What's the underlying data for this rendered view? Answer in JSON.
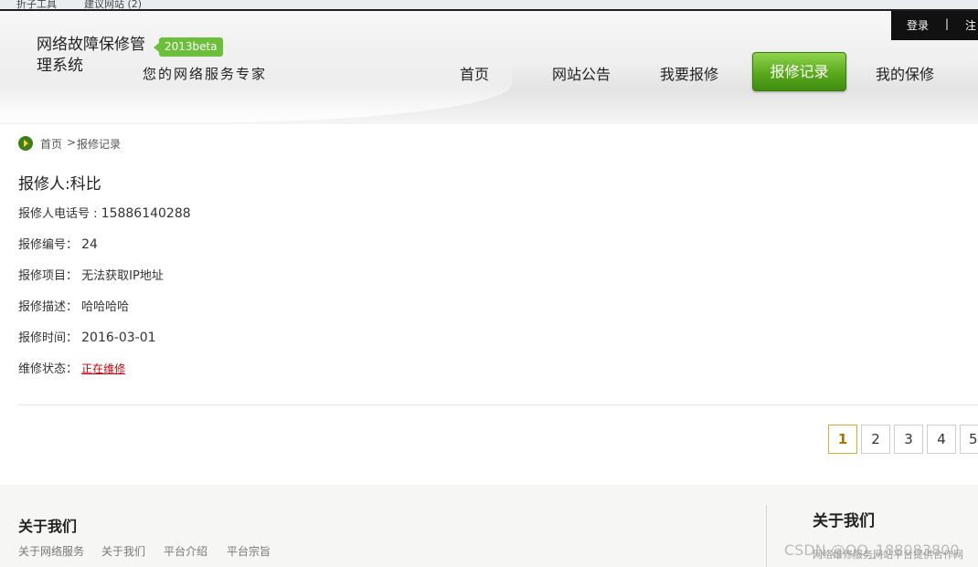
{
  "browser": {
    "tab1": "折子工具",
    "tab2": "建议网站 (2)"
  },
  "header": {
    "logo_text": "网络故障保修管理系统",
    "beta": "2013beta",
    "slogan": "您的网络服务专家",
    "login": "登录",
    "separator": "|",
    "register": "注"
  },
  "nav": {
    "items": [
      "首页",
      "网站公告",
      "我要报修",
      "报修记录",
      "我的保修"
    ],
    "active_index": 3
  },
  "breadcrumb": {
    "home": "首页",
    "sep": ">",
    "current": "报修记录"
  },
  "record": {
    "reporter_label": "报修人:",
    "reporter_name": "科比",
    "phone_label": "报修人电话号 : ",
    "phone": "15886140288",
    "id_label": "报修编号： ",
    "id": "24",
    "item_label": "报修项目： ",
    "item": "无法获取IP地址",
    "desc_label": "报修描述： ",
    "desc": "哈哈哈哈",
    "time_label": "报修时间： ",
    "time": "2016-03-01",
    "status_label": "维修状态： ",
    "status": "正在维修"
  },
  "pager": {
    "pages": [
      "1",
      "2",
      "3",
      "4",
      "5"
    ],
    "current": "1"
  },
  "footer": {
    "title": "关于我们",
    "links": [
      "关于网络服务",
      "关于我们",
      "平台介绍",
      "平台宗旨"
    ],
    "right_title": "关于我们",
    "right_sub": "网络维修服务网站平台提供合作网",
    "watermark": "CSDN @QQ_188083800"
  },
  "colors": {
    "accent_green": "#5aa91d",
    "status_red": "#c0000a",
    "pager_active": "#e3a43a"
  }
}
